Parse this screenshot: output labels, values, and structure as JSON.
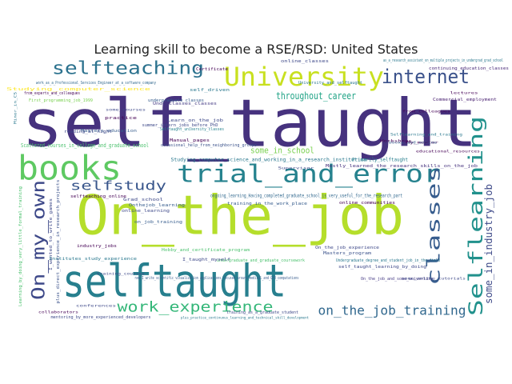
{
  "chart_data": {
    "type": "wordcloud",
    "title": "Learning skill to become a RSE/RSD: United States",
    "palette": [
      "#440154",
      "#46327e",
      "#365c8d",
      "#277f8e",
      "#1fa187",
      "#4ac16d",
      "#a0da39",
      "#fde725"
    ],
    "words": [
      {
        "text": "self_taught",
        "weight": 100,
        "color": "#46327e"
      },
      {
        "text": "On_the_job",
        "weight": 78,
        "color": "#b5de2b"
      },
      {
        "text": "selftaught",
        "weight": 66,
        "color": "#277f8e"
      },
      {
        "text": "books",
        "weight": 46,
        "color": "#5ec962"
      },
      {
        "text": "University",
        "weight": 34,
        "color": "#c8e020"
      },
      {
        "text": "trial_and_error",
        "weight": 34,
        "color": "#26828e"
      },
      {
        "text": "selfteaching",
        "weight": 26,
        "color": "#2c728e"
      },
      {
        "text": "Selflearning",
        "weight": 26,
        "color": "#21918c"
      },
      {
        "text": "internet",
        "weight": 24,
        "color": "#3b528b"
      },
      {
        "text": "classes",
        "weight": 23,
        "color": "#365c8d"
      },
      {
        "text": "On_my_own",
        "weight": 22,
        "color": "#3e4989"
      },
      {
        "text": "work_experience",
        "weight": 18,
        "color": "#35b779"
      },
      {
        "text": "on_the_job_training",
        "weight": 16,
        "color": "#31688e"
      },
      {
        "text": "selfstudy",
        "weight": 16,
        "color": "#39568c"
      },
      {
        "text": "some_in_industry_job",
        "weight": 12,
        "color": "#3e4a89"
      },
      {
        "text": "throughout_career",
        "weight": 12,
        "color": "#20a386"
      },
      {
        "text": "some_in_school",
        "weight": 10,
        "color": "#7ad151"
      },
      {
        "text": "Primarily_selftaught",
        "weight": 6,
        "color": "#277f8e"
      },
      {
        "text": "ongoing_learning_Having_completed_graduate_school_is_very_useful_for_the_research_part",
        "weight": 5,
        "color": "#31688e"
      },
      {
        "text": "Studying_computer_science_and_working_in_a_research_institution",
        "weight": 5,
        "color": "#2a788e"
      },
      {
        "text": "Scattered_courses_in_college_and_graduate_school",
        "weight": 5,
        "color": "#4ac16d"
      },
      {
        "text": "Mostly_learned_the_research_skills_on_the_job",
        "weight": 4,
        "color": "#46327e"
      },
      {
        "text": "I_wanted_to_write_games",
        "weight": 4,
        "color": "#3e4989"
      },
      {
        "text": "Learning_by_doing_very_little_formal_training",
        "weight": 3,
        "color": "#4ac16d"
      },
      {
        "text": "plus_direct_experience_in_research_projects",
        "weight": 3,
        "color": "#3b528b"
      },
      {
        "text": "now_I_write_scientific_visualization_applications_focused_around_medical_and_GPU_computations",
        "weight": 3,
        "color": "#365c8d"
      },
      {
        "text": "mentoring_by_more_experienced_developers",
        "weight": 3,
        "color": "#3e4989"
      },
      {
        "text": "as_a_research_assistant_on_multiple_projects_in_undergrad_grad_school",
        "weight": 3,
        "color": "#2a788e"
      },
      {
        "text": "continuing_education_classes",
        "weight": 3,
        "color": "#482878"
      },
      {
        "text": "work_as_a_Professional_Services_Engineer_at_a_software_company",
        "weight": 3,
        "color": "#31688e"
      },
      {
        "text": "First_programming_job_1999",
        "weight": 3,
        "color": "#7ad151"
      },
      {
        "text": "from_experts_and_colleagues",
        "weight": 3,
        "color": "#440154"
      },
      {
        "text": "Studying_computer_science",
        "weight": 3,
        "color": "#fde725"
      },
      {
        "text": "Undergraduate_degree_and_student_job_in_the_field",
        "weight": 3,
        "color": "#2a788e"
      },
      {
        "text": "self_taught_learning_by_doing",
        "weight": 3,
        "color": "#3e4989"
      },
      {
        "text": "On_the_job_and_some_university",
        "weight": 3,
        "color": "#443983"
      },
      {
        "text": "undergraduate_and_graduate_coursework",
        "weight": 3,
        "color": "#4ac16d"
      },
      {
        "text": "training_in_the_work_place",
        "weight": 3,
        "color": "#365c8d"
      },
      {
        "text": "training_as_a_graduate_student",
        "weight": 3,
        "color": "#3e4989"
      },
      {
        "text": "plus_practice_continuous_learning_and_technical_skill_development",
        "weight": 2,
        "color": "#2a788e"
      },
      {
        "text": "Masters_education",
        "weight": 3,
        "color": "#365c8d"
      },
      {
        "text": "Underclasses_classes",
        "weight": 3,
        "color": "#443983"
      },
      {
        "text": "summer_intern_jobs_before_PhD",
        "weight": 3,
        "color": "#3e4989"
      },
      {
        "text": "Selftaught_university_classes",
        "weight": 3,
        "color": "#26828e"
      },
      {
        "text": "occasional_help_from_neighboring_groups",
        "weight": 3,
        "color": "#3b528b"
      },
      {
        "text": "Manual_pages",
        "weight": 3,
        "color": "#440154"
      },
      {
        "text": "Learn_on_the_job",
        "weight": 3,
        "color": "#3e4989"
      },
      {
        "text": "University_and_selftaught",
        "weight": 3,
        "color": "#2a788e"
      },
      {
        "text": "online_classes",
        "weight": 3,
        "color": "#3e4989"
      },
      {
        "text": "online_communities",
        "weight": 3,
        "color": "#440154"
      },
      {
        "text": "Commercial_employment",
        "weight": 3,
        "color": "#481f70"
      },
      {
        "text": "reading_at_night",
        "weight": 3,
        "color": "#3e4989"
      },
      {
        "text": "undergraduate_classes",
        "weight": 3,
        "color": "#365c8d"
      },
      {
        "text": "self_driven",
        "weight": 3,
        "color": "#2a788e"
      },
      {
        "text": "Certificate",
        "weight": 3,
        "color": "#440154"
      },
      {
        "text": "Hobby_and_certificate_program",
        "weight": 3,
        "color": "#4ac16d"
      },
      {
        "text": "Onthejob_learning",
        "weight": 3,
        "color": "#365c8d"
      },
      {
        "text": "online_learning",
        "weight": 3,
        "color": "#3e4989"
      },
      {
        "text": "Grad_school",
        "weight": 3,
        "color": "#3e4989"
      },
      {
        "text": "selfteaching_online",
        "weight": 3,
        "color": "#440154"
      },
      {
        "text": "on_job_training",
        "weight": 3,
        "color": "#365c8d"
      },
      {
        "text": "industry_jobs",
        "weight": 3,
        "color": "#440154"
      },
      {
        "text": "Institutes_study_experience",
        "weight": 3,
        "color": "#2a788e"
      },
      {
        "text": "I_taught_myself",
        "weight": 3,
        "color": "#3e4989"
      },
      {
        "text": "On_the_job_experience",
        "weight": 3,
        "color": "#3e4989"
      },
      {
        "text": "Masters_program",
        "weight": 3,
        "color": "#3b528b"
      },
      {
        "text": "collaborators",
        "weight": 2,
        "color": "#440154"
      },
      {
        "text": "conferences",
        "weight": 2,
        "color": "#3e4989"
      },
      {
        "text": "practice",
        "weight": 2,
        "color": "#440154"
      },
      {
        "text": "Supervisor",
        "weight": 2,
        "color": "#3e4989"
      },
      {
        "text": "some_online_tutorials",
        "weight": 2,
        "color": "#3e4989"
      },
      {
        "text": "from_colleagues",
        "weight": 2,
        "color": "#440154"
      },
      {
        "text": "educational_resources",
        "weight": 2,
        "color": "#440154"
      },
      {
        "text": "Selflearning_and_training",
        "weight": 2,
        "color": "#2a788e"
      },
      {
        "text": "Minor_in_CS",
        "weight": 2,
        "color": "#2a788e"
      },
      {
        "text": "My_mentor",
        "weight": 2,
        "color": "#440154"
      },
      {
        "text": "some_courses",
        "weight": 2,
        "color": "#3e4989"
      },
      {
        "text": "books_and_online",
        "weight": 2,
        "color": "#365c8d"
      },
      {
        "text": "Workshops",
        "weight": 2,
        "color": "#440154"
      },
      {
        "text": "training_courses",
        "weight": 2,
        "color": "#3e4989"
      },
      {
        "text": "lectures",
        "weight": 2,
        "color": "#440154"
      }
    ]
  }
}
